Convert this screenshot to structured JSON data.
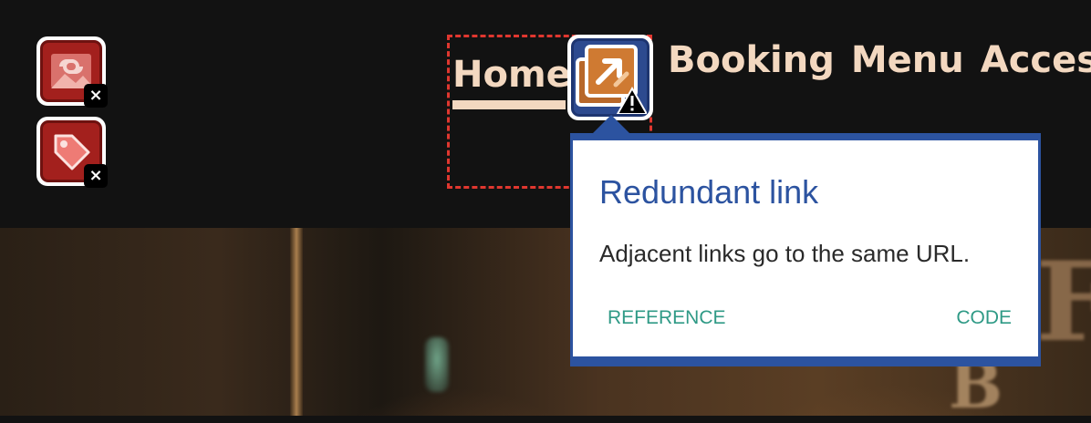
{
  "issues": [
    {
      "icon": "linked-image-icon",
      "badge": "×"
    },
    {
      "icon": "tag-icon",
      "badge": "×"
    }
  ],
  "nav": {
    "items": [
      "Home",
      "Booking",
      "Menu",
      "Acces"
    ]
  },
  "alert_button": {
    "icon": "external-link-warning-icon"
  },
  "tooltip": {
    "title": "Redundant link",
    "body": "Adjacent links go to the same URL.",
    "reference_label": "REFERENCE",
    "code_label": "CODE"
  },
  "colors": {
    "header_bg": "#121212",
    "nav_text": "#f3d8c0",
    "focus_outline": "#e0372f",
    "error_icon": "#a3201d",
    "alert_bg": "#2d4a8f",
    "tooltip_accent": "#2c53a0",
    "tooltip_link": "#2f9a86"
  }
}
